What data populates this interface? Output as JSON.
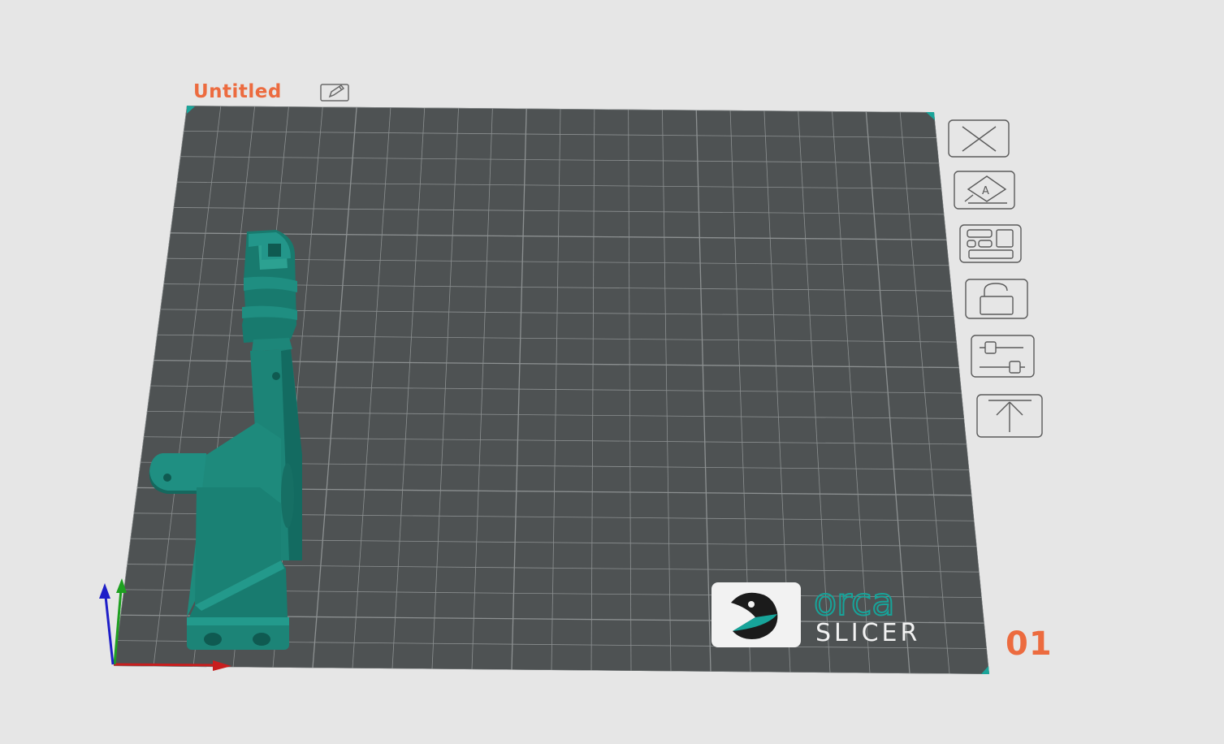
{
  "plate": {
    "title": "Untitled",
    "number": "01"
  },
  "logo": {
    "brand_top": "orca",
    "brand_bottom": "SLICER"
  },
  "toolbar": {
    "items": [
      {
        "name": "remove-plate",
        "icon": "close-icon"
      },
      {
        "name": "auto-orient",
        "icon": "auto-orient-icon"
      },
      {
        "name": "arrange",
        "icon": "arrange-icon"
      },
      {
        "name": "lock",
        "icon": "lock-icon"
      },
      {
        "name": "plate-settings",
        "icon": "sliders-icon"
      },
      {
        "name": "move-to-top",
        "icon": "move-top-icon"
      }
    ]
  },
  "colors": {
    "accent": "#ec6b3f",
    "bed": "#4e5253",
    "grid": "#8c9091",
    "model": "#1e8a7c",
    "axis_x": "#c81e1e",
    "axis_y": "#1ea020",
    "axis_z": "#1e1ec8",
    "background": "#e6e6e6"
  }
}
